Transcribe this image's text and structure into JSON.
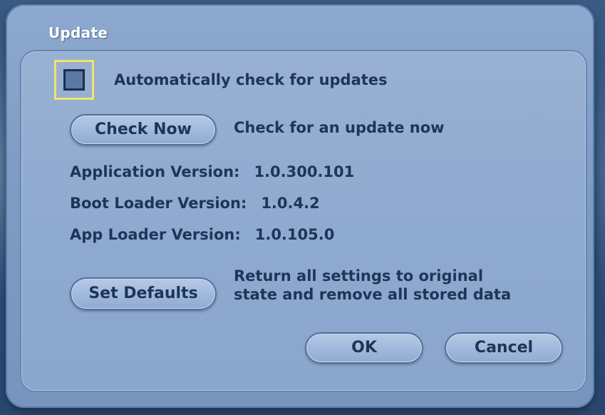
{
  "dialog": {
    "title": "Update"
  },
  "auto_check": {
    "label": "Automatically check for updates",
    "checked": false
  },
  "check_now": {
    "button_label": "Check Now",
    "description": "Check for an update now"
  },
  "versions": [
    {
      "label": "Application Version:",
      "value": "1.0.300.101"
    },
    {
      "label": "Boot Loader Version:",
      "value": "1.0.4.2"
    },
    {
      "label": "App Loader Version:",
      "value": "1.0.105.0"
    }
  ],
  "set_defaults": {
    "button_label": "Set Defaults",
    "description_line1": "Return all settings to original",
    "description_line2": "state and remove all stored data"
  },
  "footer": {
    "ok_label": "OK",
    "cancel_label": "Cancel"
  },
  "colors": {
    "background": "#2c4d78",
    "dialog": "#8ea9cf",
    "focus_highlight": "#f3e36a",
    "text": "#1f3557",
    "title_text": "#ffffff"
  }
}
